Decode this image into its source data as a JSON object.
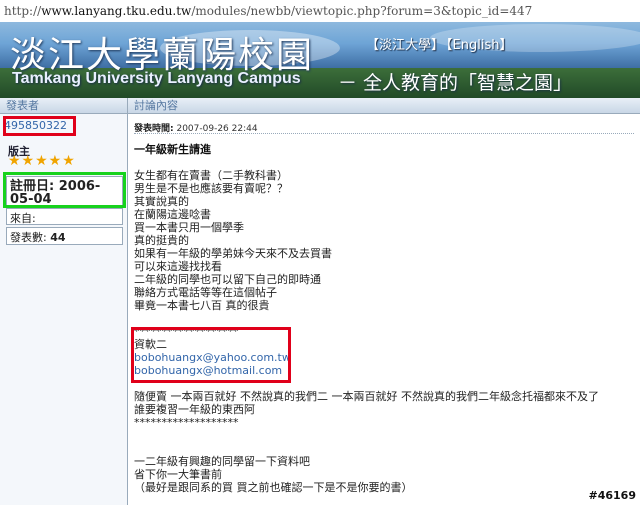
{
  "url": {
    "prefix": "http://",
    "domain": "www.lanyang.tku.edu.tw",
    "path": "/modules/newbb/viewtopic.php?forum=3&topic_id=447"
  },
  "banner": {
    "title": "淡江大學蘭陽校園",
    "subtitle": "Tamkang University Lanyang Campus",
    "slogan": "－ 全人教育的「智慧之園」",
    "links": [
      "【淡江大學】",
      "【English】"
    ]
  },
  "table": {
    "col_author": "發表者",
    "col_content": "討論內容"
  },
  "author": {
    "username": "495850322",
    "rank": "版主",
    "stars": "★★★★★",
    "reg_label": "註冊日:",
    "reg_date": "2006-05-04",
    "from_label": "來自:",
    "posts_label": "發表數:",
    "posts_count": "44"
  },
  "post": {
    "time_label": "發表時間:",
    "time_value": "2007-09-26 22:44",
    "title": "一年級新生請進",
    "lines": [
      "女生都有在賣書（二手教科書）",
      "男生是不是也應該要有賣呢？？",
      "其實說真的",
      "在蘭陽這邊唸書",
      "買一本書只用一個學季",
      "真的挺貴的",
      "如果有一年級的學弟妹今天來不及去買書",
      "可以來這邊找找看",
      "二年級的同學也可以留下自己的即時通",
      "聯絡方式電話等等在這個帖子",
      "畢竟一本書七八百 真的很貴",
      "",
      "*******************",
      "資軟二",
      "bobohuangx@yahoo.com.tw",
      "bobohuangx@hotmail.com",
      "",
      "隨便賣 一本兩百就好 不然說真的我們二 一本兩百就好 不然說真的我們二年級念托福都來不及了",
      "誰要複習一年級的東西阿",
      "*******************",
      "",
      "",
      "一二年級有興趣的同學留一下資料吧",
      "省下你一大筆書前",
      "（最好是跟同系的買 買之前也確認一下是不是你要的書）"
    ]
  },
  "watermark": "#46169"
}
